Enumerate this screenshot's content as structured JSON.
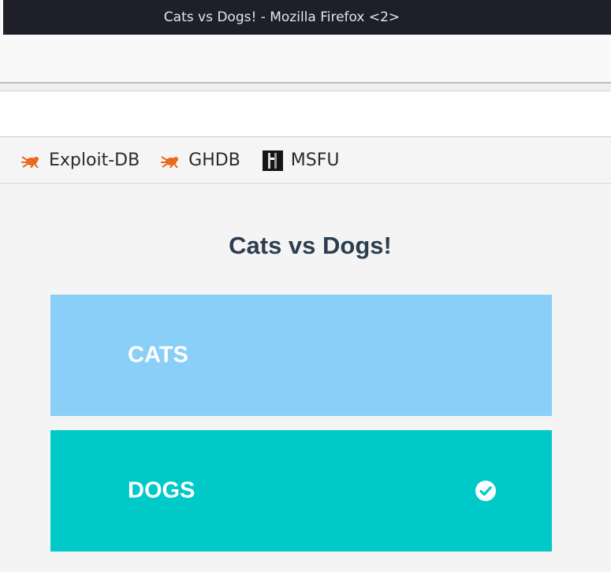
{
  "window": {
    "title": "Cats vs Dogs! - Mozilla Firefox <2>"
  },
  "bookmarks": [
    {
      "label": "Exploit-DB",
      "icon": "spider-icon"
    },
    {
      "label": "GHDB",
      "icon": "spider-icon"
    },
    {
      "label": "MSFU",
      "icon": "msfu-icon"
    }
  ],
  "page": {
    "heading": "Cats vs Dogs!",
    "options": [
      {
        "label": "CATS",
        "selected": false,
        "color": "#89cff8"
      },
      {
        "label": "DOGS",
        "selected": true,
        "color": "#00c9c9"
      }
    ]
  }
}
